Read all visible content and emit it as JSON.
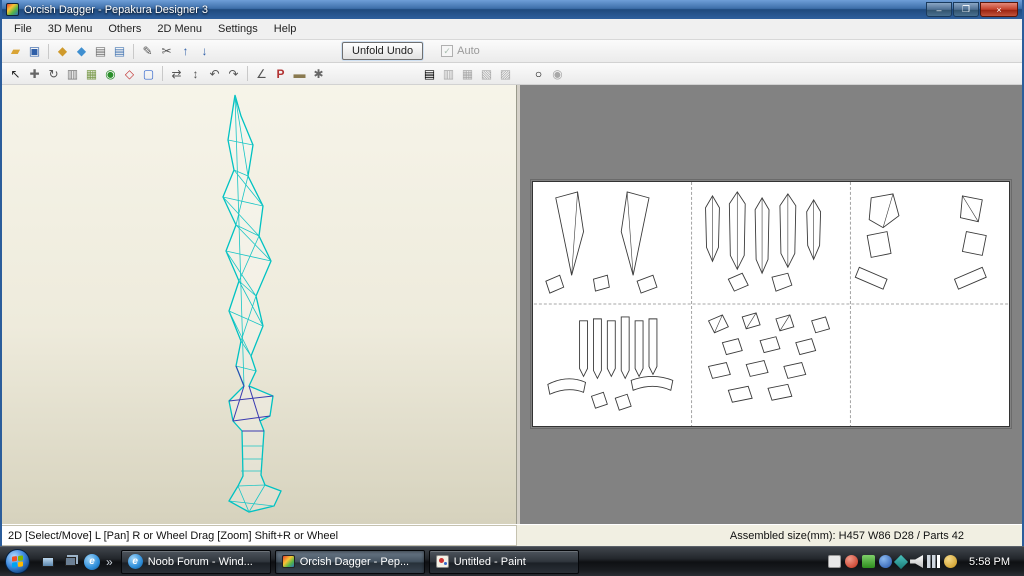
{
  "window": {
    "title": "Orcish Dagger - Pepakura Designer 3",
    "controls": [
      {
        "name": "minimize",
        "glyph": "–"
      },
      {
        "name": "maximize",
        "glyph": "❐"
      },
      {
        "name": "close",
        "glyph": "×"
      }
    ]
  },
  "menu": {
    "items": [
      "File",
      "3D Menu",
      "Others",
      "2D Menu",
      "Settings",
      "Help"
    ]
  },
  "toolbar": {
    "unfold_undo": "Unfold Undo",
    "auto": "Auto",
    "auto_checked": true
  },
  "icons": {
    "row1": [
      {
        "name": "open-folder-icon",
        "glyph": "▰",
        "color": "#d9a435"
      },
      {
        "name": "save-icon",
        "glyph": "▣",
        "color": "#2f5fa8"
      },
      {
        "name": "pattern-icon",
        "glyph": "◆",
        "color": "#cf9a2c"
      },
      {
        "name": "material-icon",
        "glyph": "◆",
        "color": "#3f8fd0"
      },
      {
        "name": "print-icon",
        "glyph": "▤",
        "color": "#707070"
      },
      {
        "name": "print-setup-icon",
        "glyph": "▤",
        "color": "#4a7ab5"
      },
      {
        "name": "edit-icon",
        "glyph": "✎",
        "color": "#555555"
      },
      {
        "name": "cut-icon",
        "glyph": "✂",
        "color": "#555555"
      },
      {
        "name": "move-up-icon",
        "glyph": "↑",
        "color": "#2f5fa8"
      },
      {
        "name": "move-down-icon",
        "glyph": "↓",
        "color": "#2f5fa8"
      }
    ],
    "row2": [
      {
        "name": "select-icon",
        "glyph": "↖",
        "color": "#222222"
      },
      {
        "name": "move-part-icon",
        "glyph": "✚",
        "color": "#666666"
      },
      {
        "name": "rotate-part-icon",
        "glyph": "↻",
        "color": "#555555"
      },
      {
        "name": "divide-icon",
        "glyph": "▥",
        "color": "#777777"
      },
      {
        "name": "texture-icon",
        "glyph": "▦",
        "color": "#7a9a4a"
      },
      {
        "name": "info-icon",
        "glyph": "◉",
        "color": "#2a8f2a"
      },
      {
        "name": "flap-icon",
        "glyph": "◇",
        "color": "#c23333"
      },
      {
        "name": "monitor-icon",
        "glyph": "▢",
        "color": "#3366cc"
      },
      {
        "name": "join-edge-icon",
        "glyph": "⇄",
        "color": "#555555"
      },
      {
        "name": "detach-icon",
        "glyph": "↕",
        "color": "#555555"
      },
      {
        "name": "rotate-left-icon",
        "glyph": "↶",
        "color": "#555555"
      },
      {
        "name": "rotate-right-icon",
        "glyph": "↷",
        "color": "#555555"
      },
      {
        "name": "ruler-icon",
        "glyph": "∠",
        "color": "#555555"
      },
      {
        "name": "part-number-icon",
        "glyph": "P",
        "color": "#b23333"
      },
      {
        "name": "sheet-icon",
        "glyph": "▬",
        "color": "#8a7a50"
      },
      {
        "name": "settings2d-icon",
        "glyph": "✱",
        "color": "#666666"
      }
    ],
    "row2_disabled": [
      {
        "name": "align-left-icon",
        "glyph": "▤",
        "color": "#a8a8a8"
      },
      {
        "name": "align-center-icon",
        "glyph": "▥",
        "color": "#a8a8a8"
      },
      {
        "name": "align-right-icon",
        "glyph": "▦",
        "color": "#a8a8a8"
      },
      {
        "name": "distribute-h-icon",
        "glyph": "▧",
        "color": "#a8a8a8"
      },
      {
        "name": "distribute-v-icon",
        "glyph": "▨",
        "color": "#a8a8a8"
      }
    ],
    "row2_zoom": [
      {
        "name": "zoom-out-icon",
        "glyph": "○",
        "color": "#a8a8a8"
      },
      {
        "name": "zoom-reset-icon",
        "glyph": "◉",
        "color": "#a8a8a8"
      }
    ]
  },
  "status": {
    "hint": "2D [Select/Move] L [Pan] R or Wheel Drag [Zoom] Shift+R or Wheel",
    "assembled": "Assembled size(mm): H457 W86 D28 / Parts 42"
  },
  "taskbar": {
    "overflow_chevron": "»",
    "ie_letter": "e",
    "buttons": [
      {
        "icon": "ie",
        "label": "Noob Forum - Wind...",
        "active": false
      },
      {
        "icon": "pepakura",
        "label": "Orcish Dagger - Pep...",
        "active": true
      },
      {
        "icon": "paint",
        "label": "Untitled - Paint",
        "active": false
      }
    ],
    "clock": "5:58 PM"
  },
  "colors": {
    "titlebar_blue": "#2b5d9b",
    "wireframe_cyan": "#00c8c8",
    "wireframe_dark": "#3a3ab0",
    "pattern_stroke": "#3a3a3a"
  },
  "pattern_page": {
    "columns": 3,
    "rows": 2,
    "filled_cells": 5
  }
}
